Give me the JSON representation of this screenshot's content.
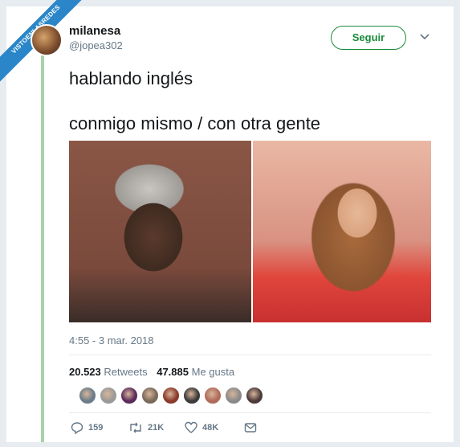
{
  "watermark": {
    "line1": "VISTOENLASREDES",
    "line2": ".com"
  },
  "user": {
    "name": "milanesa",
    "handle": "@jopea302"
  },
  "follow_button": {
    "label": "Seguir"
  },
  "tweet": {
    "line1": "hablando inglés",
    "line2": "conmigo mismo / con otra gente"
  },
  "timestamp": "4:55 - 3 mar. 2018",
  "stats": {
    "retweets_count": "20.523",
    "retweets_label": "Retweets",
    "likes_count": "47.885",
    "likes_label": "Me gusta"
  },
  "likers": [
    {
      "icon": "avatar",
      "color": "#6b7d8a"
    },
    {
      "icon": "avatar",
      "color": "#9a9a9a"
    },
    {
      "icon": "avatar",
      "color": "#5a2a5a"
    },
    {
      "icon": "avatar",
      "color": "#7a6a5a"
    },
    {
      "icon": "avatar",
      "color": "#8a3a2a"
    },
    {
      "icon": "avatar",
      "color": "#3a3a3a"
    },
    {
      "icon": "avatar",
      "color": "#b06a5a"
    },
    {
      "icon": "avatar",
      "color": "#8a8a8a"
    },
    {
      "icon": "avatar",
      "color": "#4a3a3a"
    }
  ],
  "actions": {
    "replies": "159",
    "retweets": "21K",
    "likes": "48K"
  },
  "colors": {
    "accent": "#1a8a3a",
    "muted": "#657786",
    "thread_line": "#a8d3a8",
    "ribbon": "#2a86c9"
  }
}
